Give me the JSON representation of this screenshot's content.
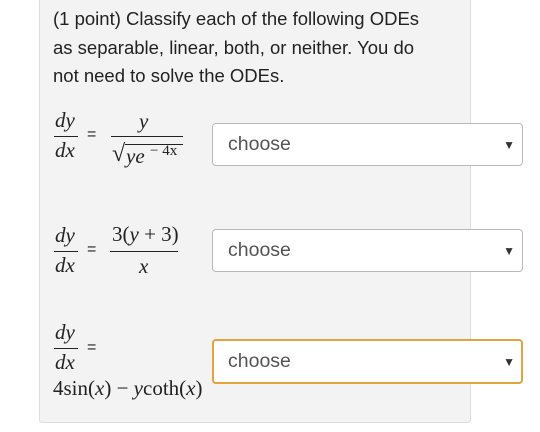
{
  "question": {
    "points_label": "(1 point)",
    "prompt_line1": "Classify each of the following ODEs",
    "prompt_line2": "as separable, linear, both, or neither. You do",
    "prompt_line3": "not need to solve the ODEs."
  },
  "equations": [
    {
      "lhs_num": "dy",
      "lhs_den": "dx",
      "equals": "=",
      "rhs_num": "y",
      "rhs_den_base": "ye",
      "rhs_den_exp": "− 4x",
      "radical": "√"
    },
    {
      "lhs_num": "dy",
      "lhs_den": "dx",
      "equals": "=",
      "rhs_num_pre": "3(",
      "rhs_num_var": "y",
      "rhs_num_post": " + 3)",
      "rhs_den": "x"
    },
    {
      "lhs_num": "dy",
      "lhs_den": "dx",
      "equals": "=",
      "rhs_a": "4sin(",
      "rhs_b": "x",
      "rhs_c": ") − ",
      "rhs_d": "y",
      "rhs_e": "coth(",
      "rhs_f": "x",
      "rhs_g": ")"
    }
  ],
  "selects": [
    {
      "value": "choose",
      "arrow": "▼"
    },
    {
      "value": "choose",
      "arrow": "▼"
    },
    {
      "value": "choose",
      "arrow": "▼"
    }
  ],
  "colors": {
    "focus_border": "#e6a23c",
    "panel_background": "#f3f3f3"
  }
}
